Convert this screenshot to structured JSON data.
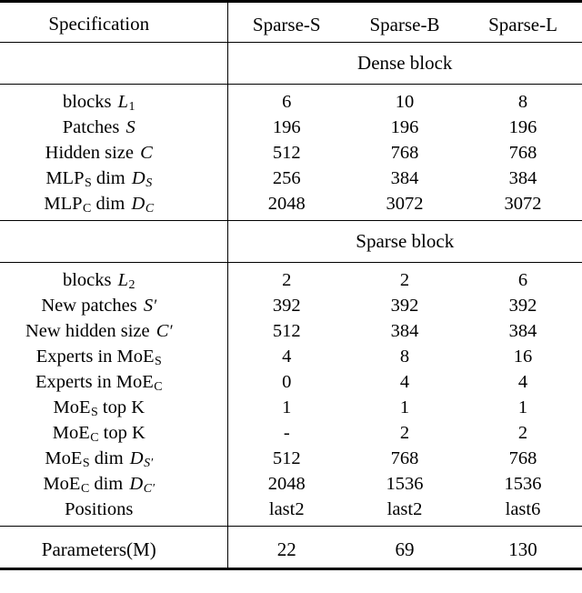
{
  "table": {
    "columns": [
      "Specification",
      "Sparse-S",
      "Sparse-B",
      "Sparse-L"
    ],
    "sections": [
      {
        "banner": "Dense block",
        "rows": [
          {
            "label_plain": "blocks L1",
            "values": [
              "6",
              "10",
              "8"
            ]
          },
          {
            "label_plain": "Patches S",
            "values": [
              "196",
              "196",
              "196"
            ]
          },
          {
            "label_plain": "Hidden size C",
            "values": [
              "512",
              "768",
              "768"
            ]
          },
          {
            "label_plain": "MLP_S dim D_S",
            "values": [
              "256",
              "384",
              "384"
            ]
          },
          {
            "label_plain": "MLP_C dim D_C",
            "values": [
              "2048",
              "3072",
              "3072"
            ]
          }
        ]
      },
      {
        "banner": "Sparse block",
        "rows": [
          {
            "label_plain": "blocks L2",
            "values": [
              "2",
              "2",
              "6"
            ]
          },
          {
            "label_plain": "New patches S'",
            "values": [
              "392",
              "392",
              "392"
            ]
          },
          {
            "label_plain": "New hidden size C'",
            "values": [
              "512",
              "384",
              "384"
            ]
          },
          {
            "label_plain": "Experts in MoE_S",
            "values": [
              "4",
              "8",
              "16"
            ]
          },
          {
            "label_plain": "Experts in MoE_C",
            "values": [
              "0",
              "4",
              "4"
            ]
          },
          {
            "label_plain": "MoE_S top K",
            "values": [
              "1",
              "1",
              "1"
            ]
          },
          {
            "label_plain": "MoE_C top K",
            "values": [
              "-",
              "2",
              "2"
            ]
          },
          {
            "label_plain": "MoE_S dim D_S'",
            "values": [
              "512",
              "768",
              "768"
            ]
          },
          {
            "label_plain": "MoE_C dim D_C'",
            "values": [
              "2048",
              "1536",
              "1536"
            ]
          },
          {
            "label_plain": "Positions",
            "values": [
              "last2",
              "last2",
              "last6"
            ]
          }
        ]
      }
    ],
    "total": {
      "label": "Parameters(M)",
      "values": [
        "22",
        "69",
        "130"
      ]
    }
  },
  "labels": {
    "header_spec": "Specification",
    "header_s": "Sparse-S",
    "header_b": "Sparse-B",
    "header_l": "Sparse-L",
    "banner_dense": "Dense block",
    "banner_sparse": "Sparse block",
    "r_blocks": "blocks",
    "r_patches": "Patches",
    "r_hidden": "Hidden size",
    "r_mlp": "MLP",
    "r_dim": "dim",
    "r_new_patches": "New patches",
    "r_new_hidden": "New hidden size",
    "r_experts_in": "Experts in",
    "r_moe": "MoE",
    "r_topk": "top K",
    "r_positions": "Positions",
    "r_parameters": "Parameters(M)",
    "sub_1": "1",
    "sub_2": "2",
    "sub_S": "S",
    "sub_C": "C",
    "var_L": "L",
    "var_S": "S",
    "var_C": "C",
    "var_D": "D",
    "prime": "′"
  },
  "values": {
    "d_blocks": [
      "6",
      "10",
      "8"
    ],
    "d_patches": [
      "196",
      "196",
      "196"
    ],
    "d_hidden": [
      "512",
      "768",
      "768"
    ],
    "d_mlps": [
      "256",
      "384",
      "384"
    ],
    "d_mlpc": [
      "2048",
      "3072",
      "3072"
    ],
    "s_blocks": [
      "2",
      "2",
      "6"
    ],
    "s_newpatches": [
      "392",
      "392",
      "392"
    ],
    "s_newhidden": [
      "512",
      "384",
      "384"
    ],
    "s_experts_s": [
      "4",
      "8",
      "16"
    ],
    "s_experts_c": [
      "0",
      "4",
      "4"
    ],
    "s_topk_s": [
      "1",
      "1",
      "1"
    ],
    "s_topk_c": [
      "-",
      "2",
      "2"
    ],
    "s_dim_s": [
      "512",
      "768",
      "768"
    ],
    "s_dim_c": [
      "2048",
      "1536",
      "1536"
    ],
    "s_positions": [
      "last2",
      "last2",
      "last6"
    ],
    "total": [
      "22",
      "69",
      "130"
    ]
  },
  "style": {
    "text_color": "#000000",
    "background": "#ffffff",
    "rule_color": "#000000"
  }
}
